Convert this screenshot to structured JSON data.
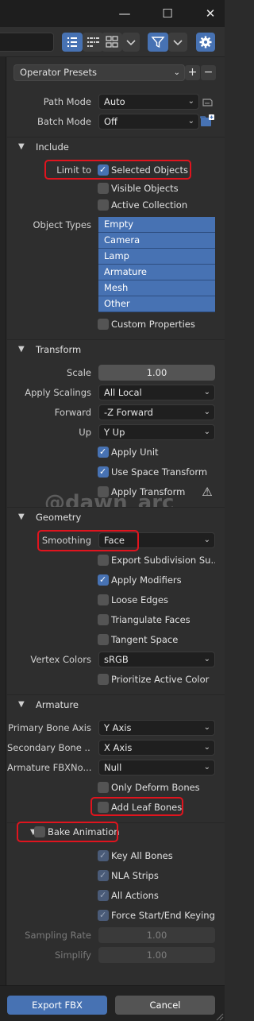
{
  "window": {
    "minimize": "—",
    "maximize": "☐",
    "close": "✕"
  },
  "presets": {
    "label": "Operator Presets",
    "add": "+",
    "remove": "−"
  },
  "top": {
    "path_mode": {
      "label": "Path Mode",
      "value": "Auto"
    },
    "batch_mode": {
      "label": "Batch Mode",
      "value": "Off"
    }
  },
  "include": {
    "title": "Include",
    "limit_to_label": "Limit to",
    "selected_objects": "Selected Objects",
    "visible_objects": "Visible Objects",
    "active_collection": "Active Collection",
    "object_types_label": "Object Types",
    "object_types": [
      "Empty",
      "Camera",
      "Lamp",
      "Armature",
      "Mesh",
      "Other"
    ],
    "custom_properties": "Custom Properties"
  },
  "transform": {
    "title": "Transform",
    "scale_label": "Scale",
    "scale_value": "1.00",
    "apply_scalings_label": "Apply Scalings",
    "apply_scalings_value": "All Local",
    "forward_label": "Forward",
    "forward_value": "-Z Forward",
    "up_label": "Up",
    "up_value": "Y Up",
    "apply_unit": "Apply Unit",
    "use_space_transform": "Use Space Transform",
    "apply_transform": "Apply Transform"
  },
  "watermark": "@dawn_arc",
  "geometry": {
    "title": "Geometry",
    "smoothing_label": "Smoothing",
    "smoothing_value": "Face",
    "export_subdivision": "Export Subdivision Su...",
    "apply_modifiers": "Apply Modifiers",
    "loose_edges": "Loose Edges",
    "triangulate_faces": "Triangulate Faces",
    "tangent_space": "Tangent Space",
    "vertex_colors_label": "Vertex Colors",
    "vertex_colors_value": "sRGB",
    "prioritize_active_color": "Prioritize Active Color"
  },
  "armature": {
    "title": "Armature",
    "primary_bone_axis_label": "Primary Bone Axis",
    "primary_bone_axis_value": "Y Axis",
    "secondary_bone_label": "Secondary Bone ...",
    "secondary_bone_value": "X Axis",
    "armature_fbx_label": "Armature FBXNo...",
    "armature_fbx_value": "Null",
    "only_deform_bones": "Only Deform Bones",
    "add_leaf_bones": "Add Leaf Bones"
  },
  "bake": {
    "title": "Bake Animation",
    "key_all_bones": "Key All Bones",
    "nla_strips": "NLA Strips",
    "all_actions": "All Actions",
    "force_start_end": "Force Start/End Keying",
    "sampling_rate_label": "Sampling Rate",
    "sampling_rate_value": "1.00",
    "simplify_label": "Simplify",
    "simplify_value": "1.00"
  },
  "footer": {
    "export": "Export FBX",
    "cancel": "Cancel"
  },
  "colors": {
    "accent": "#4772b3",
    "highlight": "#e0141e",
    "panel": "#2e2e2e"
  }
}
